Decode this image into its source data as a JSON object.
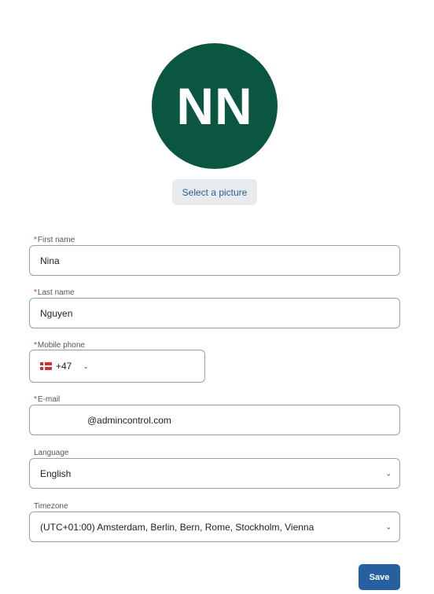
{
  "avatar": {
    "initials": "NN",
    "color": "#0a5640"
  },
  "picture_button": {
    "label": "Select a picture"
  },
  "required_marker": "*",
  "first_name": {
    "label": "First name",
    "value": "Nina"
  },
  "last_name": {
    "label": "Last name",
    "value": "Nguyen"
  },
  "mobile_phone": {
    "label": "Mobile phone",
    "country_code": "+47",
    "flag_icon": "norway-flag-icon"
  },
  "email": {
    "label": "E-mail",
    "value": "@admincontrol.com"
  },
  "language": {
    "label": "Language",
    "value": "English"
  },
  "timezone": {
    "label": "Timezone",
    "value": "(UTC+01:00) Amsterdam, Berlin, Bern, Rome, Stockholm, Vienna"
  },
  "save_button": {
    "label": "Save",
    "color": "#2660a0"
  },
  "icons": {
    "chevron": "chevron-down-icon"
  }
}
